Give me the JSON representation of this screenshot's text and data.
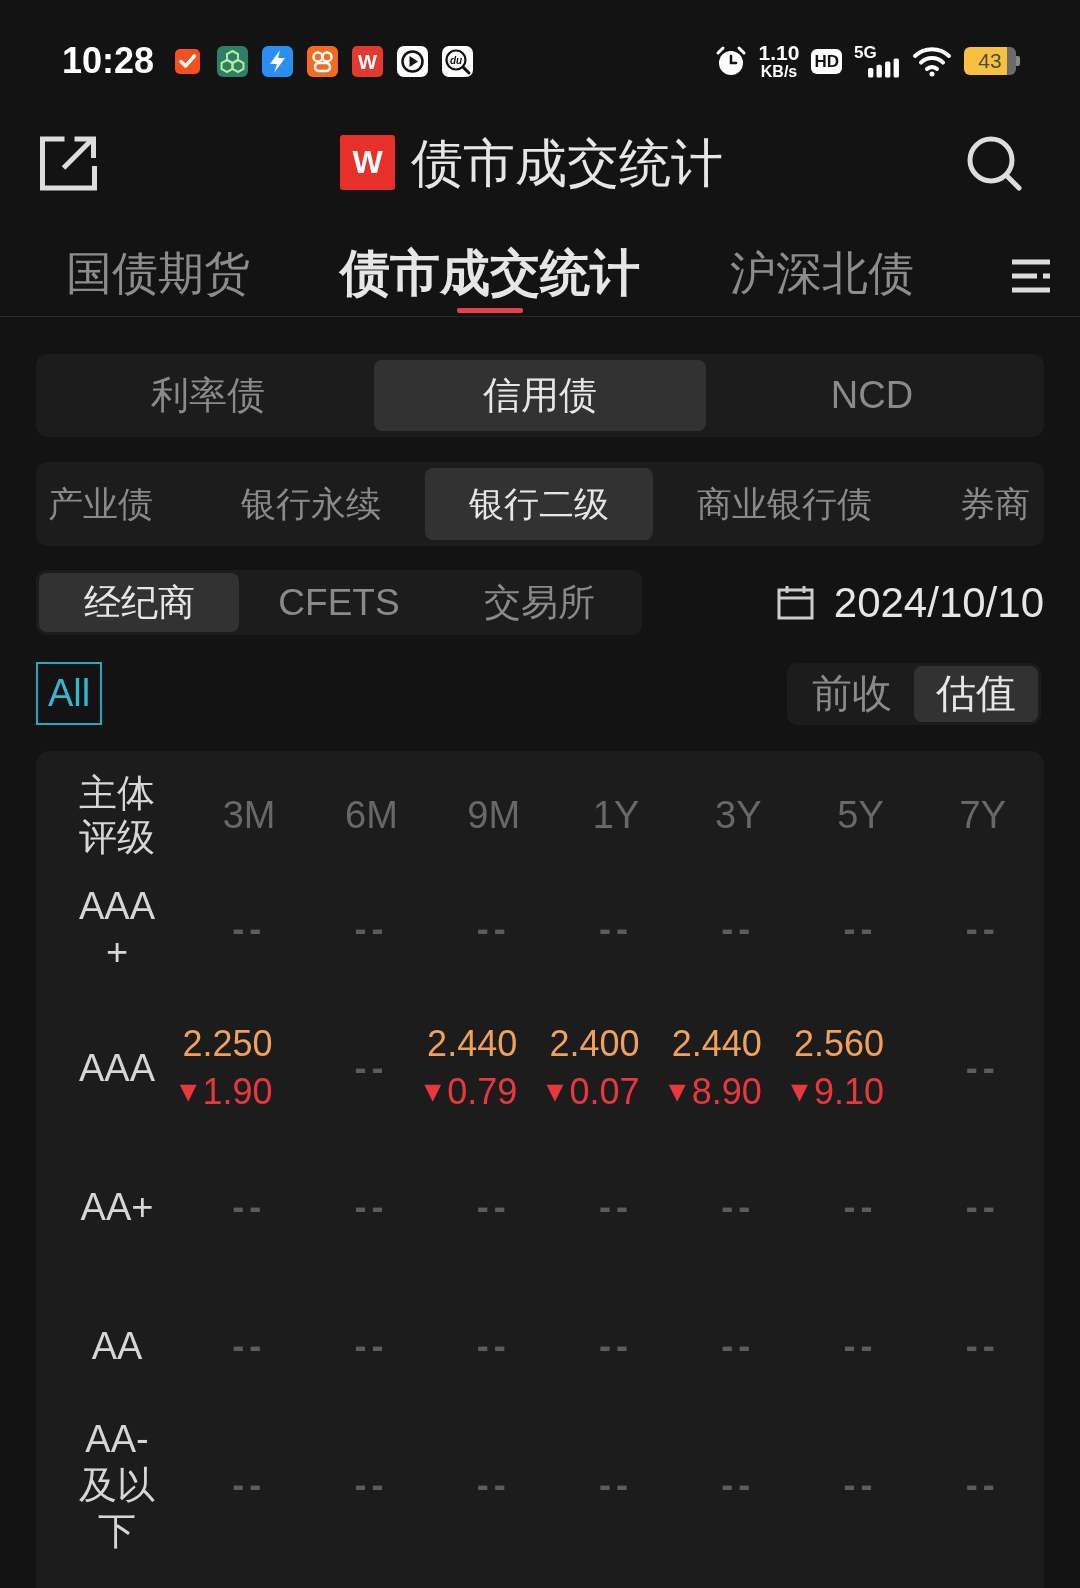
{
  "status_bar": {
    "time": "10:28",
    "app_icons": [
      {
        "kind": "task"
      },
      {
        "kind": "cube"
      },
      {
        "kind": "bolt"
      },
      {
        "kind": "flower"
      },
      {
        "kind": "letter",
        "letter": "W"
      },
      {
        "kind": "play"
      },
      {
        "kind": "magnifier",
        "letter": "du"
      }
    ],
    "speed": "1.10",
    "speed_unit": "KB/s",
    "hd": "HD",
    "network": "5G",
    "battery": "43"
  },
  "header": {
    "logo_letter": "W",
    "title": "债市成交统计"
  },
  "tabs": [
    {
      "label": "国债期货",
      "selected": false
    },
    {
      "label": "债市成交统计",
      "selected": true
    },
    {
      "label": "沪深北债",
      "selected": false
    }
  ],
  "bond_types": [
    {
      "label": "利率债",
      "selected": false
    },
    {
      "label": "信用债",
      "selected": true
    },
    {
      "label": "NCD",
      "selected": false
    }
  ],
  "sub_types": [
    {
      "label": "产业债",
      "selected": false
    },
    {
      "label": "银行永续",
      "selected": false
    },
    {
      "label": "银行二级",
      "selected": true
    },
    {
      "label": "商业银行债",
      "selected": false
    },
    {
      "label": "券商",
      "selected": false
    }
  ],
  "sources": [
    {
      "label": "经纪商",
      "selected": true
    },
    {
      "label": "CFETS",
      "selected": false
    },
    {
      "label": "交易所",
      "selected": false
    }
  ],
  "date": "2024/10/10",
  "filter": {
    "label": "All",
    "selected": true
  },
  "price_modes": [
    {
      "label": "前收",
      "selected": false
    },
    {
      "label": "估值",
      "selected": true
    }
  ],
  "table": {
    "columns": [
      "主体评级",
      "3M",
      "6M",
      "9M",
      "1Y",
      "3Y",
      "5Y",
      "7Y"
    ],
    "rows": [
      {
        "cells": [
          {
            "kind": "rating",
            "text": "AAA+"
          },
          {
            "kind": "empty",
            "text": "--"
          },
          {
            "kind": "empty",
            "text": "--"
          },
          {
            "kind": "empty",
            "text": "--"
          },
          {
            "kind": "empty",
            "text": "--"
          },
          {
            "kind": "empty",
            "text": "--"
          },
          {
            "kind": "empty",
            "text": "--"
          },
          {
            "kind": "empty",
            "text": "--"
          }
        ]
      },
      {
        "cells": [
          {
            "kind": "rating",
            "text": "AAA"
          },
          {
            "kind": "quote",
            "value": "2.250",
            "marker": "▼",
            "change": "1.90"
          },
          {
            "kind": "empty",
            "text": "--"
          },
          {
            "kind": "quote",
            "value": "2.440",
            "marker": "▼",
            "change": "0.79"
          },
          {
            "kind": "quote",
            "value": "2.400",
            "marker": "▼",
            "change": "0.07"
          },
          {
            "kind": "quote",
            "value": "2.440",
            "marker": "▼",
            "change": "8.90"
          },
          {
            "kind": "quote",
            "value": "2.560",
            "marker": "▼",
            "change": "9.10"
          },
          {
            "kind": "empty",
            "text": "--"
          }
        ]
      },
      {
        "cells": [
          {
            "kind": "rating",
            "text": "AA+"
          },
          {
            "kind": "empty",
            "text": "--"
          },
          {
            "kind": "empty",
            "text": "--"
          },
          {
            "kind": "empty",
            "text": "--"
          },
          {
            "kind": "empty",
            "text": "--"
          },
          {
            "kind": "empty",
            "text": "--"
          },
          {
            "kind": "empty",
            "text": "--"
          },
          {
            "kind": "empty",
            "text": "--"
          }
        ]
      },
      {
        "cells": [
          {
            "kind": "rating",
            "text": "AA"
          },
          {
            "kind": "empty",
            "text": "--"
          },
          {
            "kind": "empty",
            "text": "--"
          },
          {
            "kind": "empty",
            "text": "--"
          },
          {
            "kind": "empty",
            "text": "--"
          },
          {
            "kind": "empty",
            "text": "--"
          },
          {
            "kind": "empty",
            "text": "--"
          },
          {
            "kind": "empty",
            "text": "--"
          }
        ]
      },
      {
        "cells": [
          {
            "kind": "rating",
            "text": "AA-及以下"
          },
          {
            "kind": "empty",
            "text": "--"
          },
          {
            "kind": "empty",
            "text": "--"
          },
          {
            "kind": "empty",
            "text": "--"
          },
          {
            "kind": "empty",
            "text": "--"
          },
          {
            "kind": "empty",
            "text": "--"
          },
          {
            "kind": "empty",
            "text": "--"
          },
          {
            "kind": "empty",
            "text": "--"
          }
        ]
      }
    ]
  }
}
